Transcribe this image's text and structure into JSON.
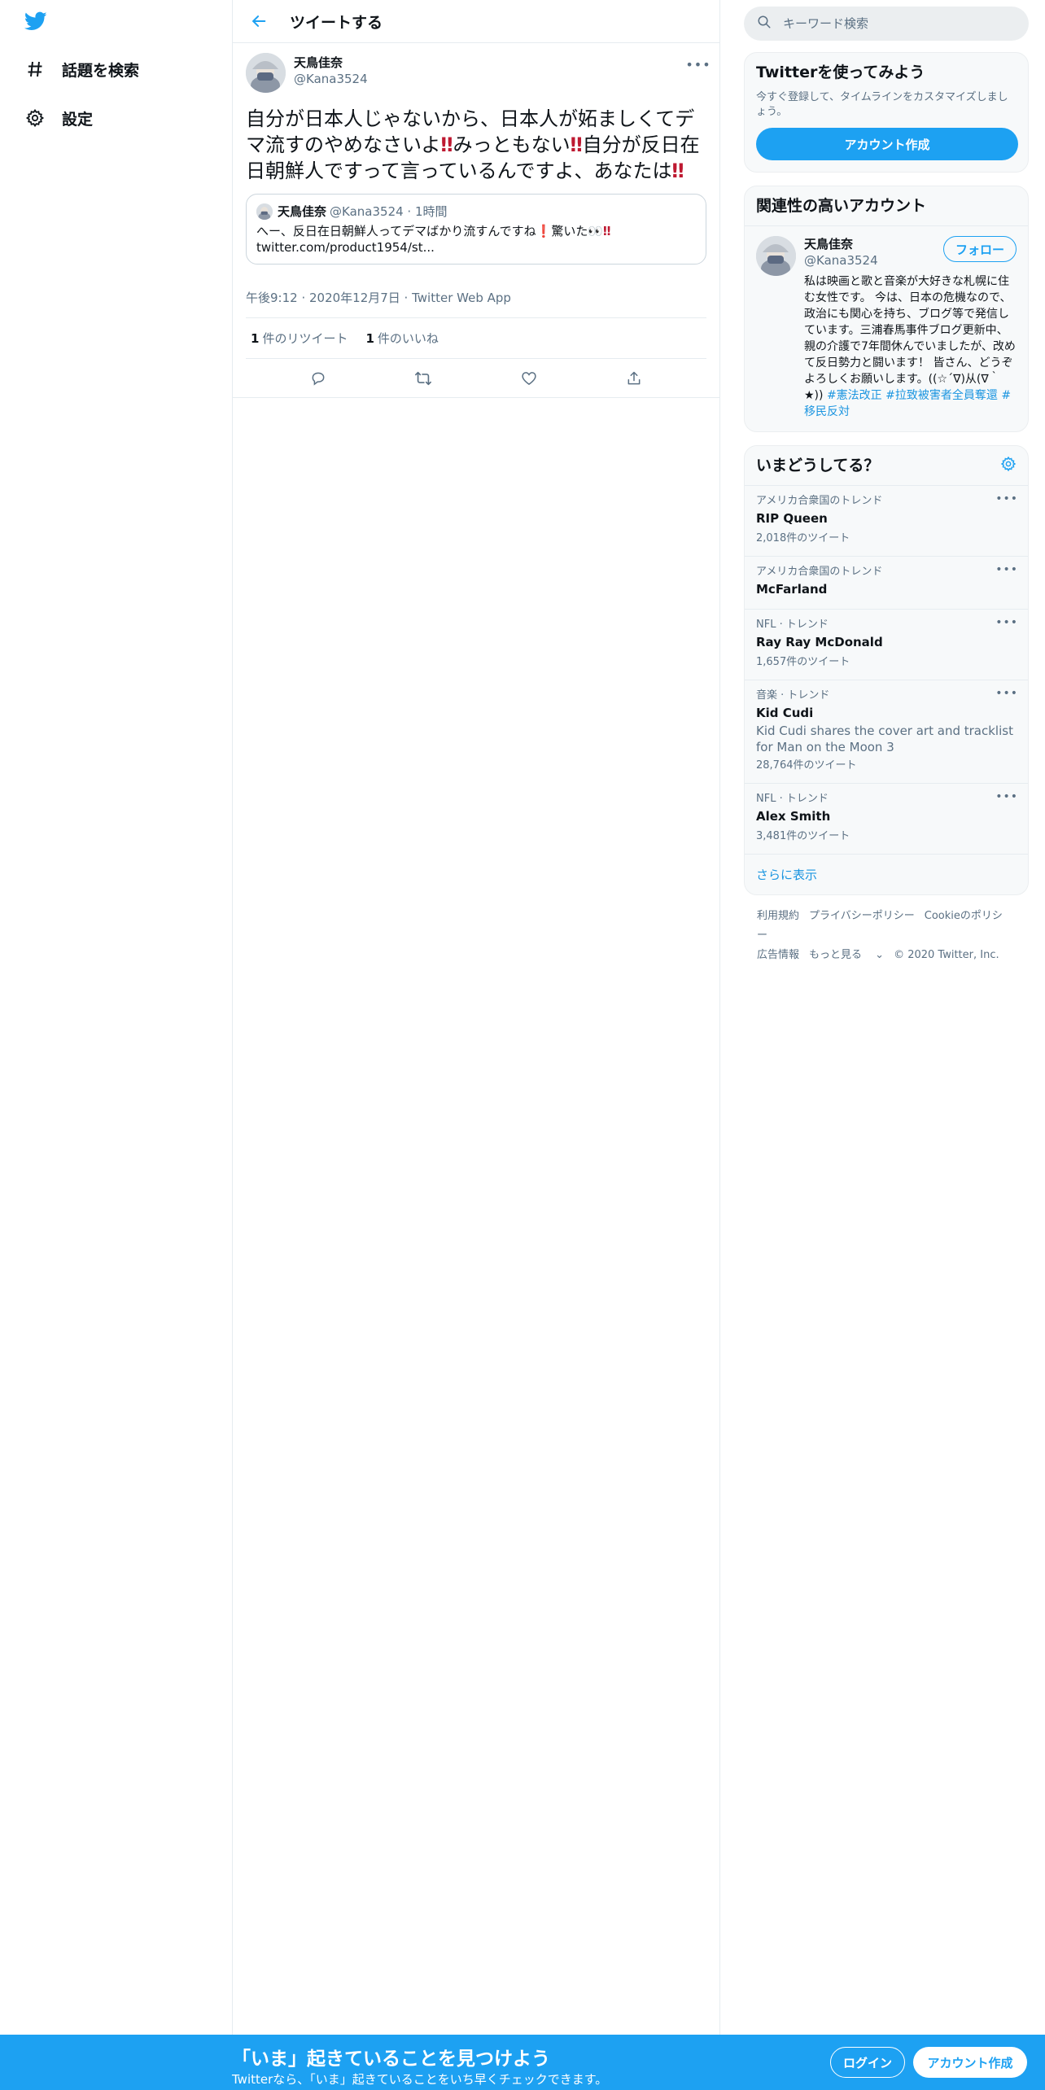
{
  "nav": {
    "explore_label": "話題を検索",
    "settings_label": "設定"
  },
  "header": {
    "title": "ツイートする"
  },
  "tweet": {
    "author_name": "天鳥佳奈",
    "author_handle": "@Kana3524",
    "text_1": "自分が日本人じゃないから、日本人が妬ましくてデマ流すのやめなさいよ",
    "emoji_1": "‼",
    "text_2": "みっともない",
    "emoji_2": "‼",
    "text_3": "自分が反日在日朝鮮人ですって言っているんですよ、あなたは",
    "emoji_3": "‼",
    "quote": {
      "name": "天鳥佳奈",
      "meta": "@Kana3524 · 1時間",
      "text_a": "へー、反日在日朝鮮人ってデマばかり流すんですね",
      "emoji_a": "❗",
      "text_b": "驚いた👀",
      "emoji_b": "‼",
      "link": "twitter.com/product1954/st..."
    },
    "timestamp": "午後9:12 · 2020年12月7日 · Twitter Web App",
    "retweet_count": "1",
    "retweet_label": "件のリツイート",
    "like_count": "1",
    "like_label": "件のいいね"
  },
  "search": {
    "placeholder": "キーワード検索"
  },
  "signup_card": {
    "title": "Twitterを使ってみよう",
    "subtitle": "今すぐ登録して、タイムラインをカスタマイズしましょう。",
    "button": "アカウント作成"
  },
  "related": {
    "title": "関連性の高いアカウント",
    "name": "天鳥佳奈",
    "handle": "@Kana3524",
    "follow": "フォロー",
    "bio": "私は映画と歌と音楽が大好きな札幌に住む女性です。 今は、日本の危機なので、政治にも関心を持ち、ブログ等で発信しています。三浦春馬事件ブログ更新中、親の介護で7年間休んでいましたが、改めて反日勢力と闘います！ 皆さん、どうぞよろしくお願いします。((☆´∇)从(∇｀★))",
    "tag1": "#憲法改正",
    "tag2": "#拉致被害者全員奪還",
    "tag3": "#移民反対"
  },
  "trends": {
    "title": "いまどうしてる？",
    "items": [
      {
        "context": "アメリカ合衆国のトレンド",
        "name": "RIP Queen",
        "desc": "",
        "count": "2,018件のツイート"
      },
      {
        "context": "アメリカ合衆国のトレンド",
        "name": "McFarland",
        "desc": "",
        "count": ""
      },
      {
        "context": "NFL · トレンド",
        "name": "Ray Ray McDonald",
        "desc": "",
        "count": "1,657件のツイート"
      },
      {
        "context": "音楽 · トレンド",
        "name": "Kid Cudi",
        "desc": "Kid Cudi shares the cover art and tracklist for Man on the Moon 3",
        "count": "28,764件のツイート"
      },
      {
        "context": "NFL · トレンド",
        "name": "Alex Smith",
        "desc": "",
        "count": "3,481件のツイート"
      }
    ],
    "show_more": "さらに表示"
  },
  "footer": {
    "terms": "利用規約",
    "privacy": "プライバシーポリシー",
    "cookies": "Cookieのポリシー",
    "ads": "広告情報",
    "more": "もっと見る",
    "copyright": "© 2020 Twitter, Inc."
  },
  "banner": {
    "title": "「いま」起きていることを見つけよう",
    "subtitle": "Twitterなら、「いま」起きていることをいち早くチェックできます。",
    "login": "ログイン",
    "signup": "アカウント作成"
  },
  "colors": {
    "accent": "#1da1f2",
    "emoji_red": "#be1931",
    "muted": "#5b7083"
  }
}
